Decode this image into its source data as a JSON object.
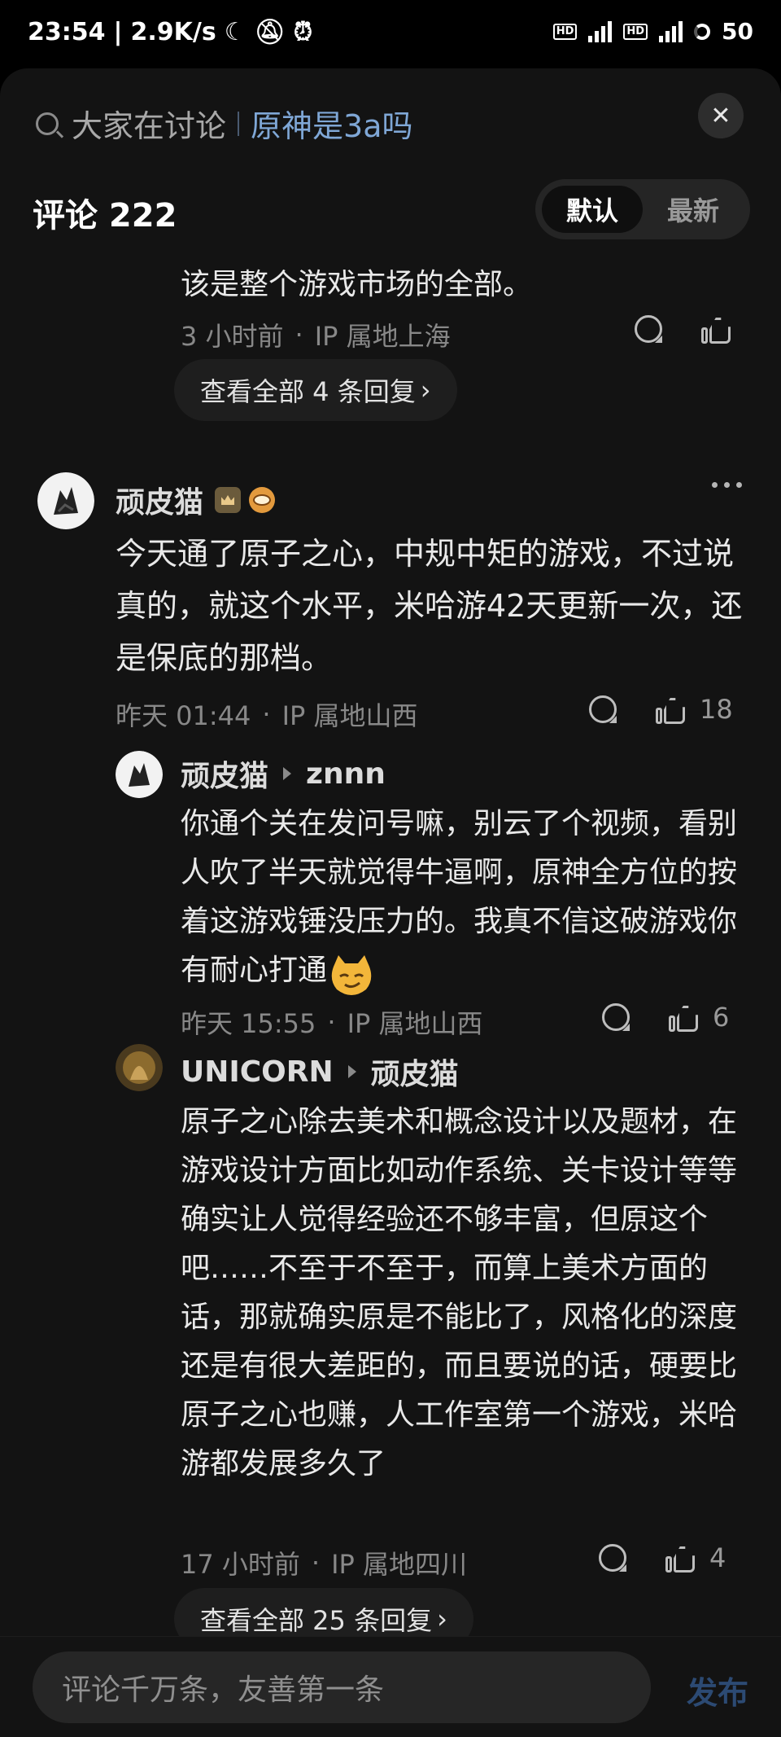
{
  "status_bar": {
    "time": "23:54",
    "speed": "2.9K/s",
    "battery": "50",
    "icons": [
      "moon-icon",
      "mute-icon",
      "alarm-icon",
      "hd-icon",
      "5g-signal-icon",
      "battery-icon"
    ]
  },
  "search": {
    "prefix": "大家在讨论",
    "topic": "原神是3a吗"
  },
  "header": {
    "title": "评论 222",
    "sort_default": "默认",
    "sort_latest": "最新"
  },
  "c0": {
    "text_tail": "该是整个游戏市场的全部。",
    "time": "3 小时前",
    "ip": "IP 属地上海",
    "view_replies": "查看全部 4 条回复"
  },
  "c1": {
    "author": "顽皮猫",
    "text": "今天通了原子之心，中规中矩的游戏，不过说真的，就这个水平，米哈游42天更新一次，还是保底的那档。",
    "time": "昨天 01:44",
    "ip": "IP 属地山西",
    "likes": "18",
    "r1": {
      "author": "顽皮猫",
      "reply_to": "znnn",
      "text": "你通个关在发问号嘛，别云了个视频，看别人吹了半天就觉得牛逼啊，原神全方位的按着这游戏锤没压力的。我真不信这破游戏你有耐心打通",
      "emoji": "cat-smirk-emoji",
      "time": "昨天 15:55",
      "ip": "IP 属地山西",
      "likes": "6"
    },
    "r2": {
      "author": "UNICORN",
      "reply_to": "顽皮猫",
      "text": "原子之心除去美术和概念设计以及题材，在游戏设计方面比如动作系统、关卡设计等等确实让人觉得经验还不够丰富，但原这个吧……不至于不至于，而算上美术方面的话，那就确实原是不能比了，风格化的深度还是有很大差距的，而且要说的话，硬要比原子之心也赚，人工作室第一个游戏，米哈游都发展多久了",
      "time": "17 小时前",
      "ip": "IP 属地四川",
      "likes": "4"
    },
    "view_replies": "查看全部 25 条回复"
  },
  "composer": {
    "placeholder": "评论千万条，友善第一条",
    "publish": "发布"
  },
  "colors": {
    "background": "#131313",
    "topic_blue": "#7fa7d6",
    "publish_blue": "#2c4a73"
  }
}
